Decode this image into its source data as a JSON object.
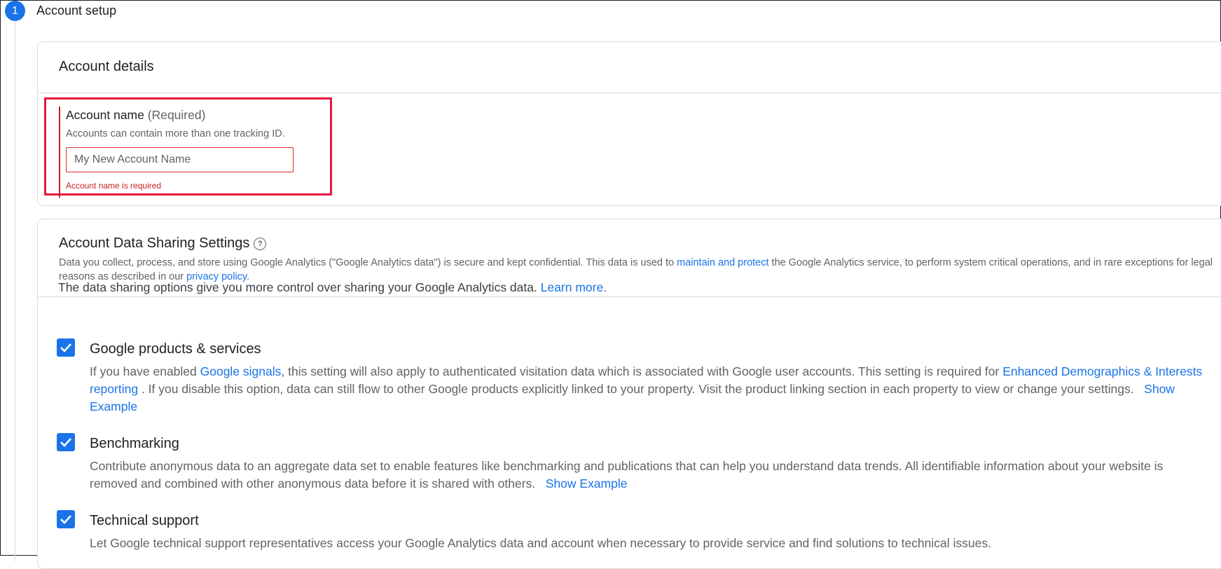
{
  "step": {
    "number": "1",
    "title": "Account setup"
  },
  "account_details": {
    "card_title": "Account details",
    "field": {
      "label": "Account name",
      "required_text": "(Required)",
      "help": "Accounts can contain more than one tracking ID.",
      "placeholder": "My New Account Name",
      "value": "",
      "error": "Account name is required"
    }
  },
  "data_sharing": {
    "title": "Account Data Sharing Settings",
    "help_icon": "help-circle-icon",
    "desc_part1": "Data you collect, process, and store using Google Analytics (\"Google Analytics data\") is secure and kept confidential. This data is used to ",
    "desc_link1": "maintain and protect",
    "desc_part2": " the Google Analytics service, to perform system critical operations, and in rare exceptions for legal reasons as described in our ",
    "desc_link2": "privacy policy",
    "desc_part3": ".",
    "intro_text": "The data sharing options give you more control over sharing your Google Analytics data.",
    "intro_link": "Learn more.",
    "options": [
      {
        "title": "Google products & services",
        "checked": true,
        "desc_part1": "If you have enabled ",
        "link1": "Google signals",
        "desc_part2": ", this setting will also apply to authenticated visitation data which is associated with Google user accounts. This setting is required for ",
        "link2": "Enhanced Demographics & Interests reporting",
        "desc_part3": " . If you disable this option, data can still flow to other Google products explicitly linked to your property. Visit the product linking section in each property to view or change your settings.",
        "show_example": "Show Example"
      },
      {
        "title": "Benchmarking",
        "checked": true,
        "desc": "Contribute anonymous data to an aggregate data set to enable features like benchmarking and publications that can help you understand data trends. All identifiable information about your website is removed and combined with other anonymous data before it is shared with others.",
        "show_example": "Show Example"
      },
      {
        "title": "Technical support",
        "checked": true,
        "desc": "Let Google technical support representatives access your Google Analytics data and account when necessary to provide service and find solutions to technical issues."
      }
    ]
  },
  "colors": {
    "accent": "#1a73e8",
    "error": "#c5221f",
    "highlight": "#e8173f"
  }
}
